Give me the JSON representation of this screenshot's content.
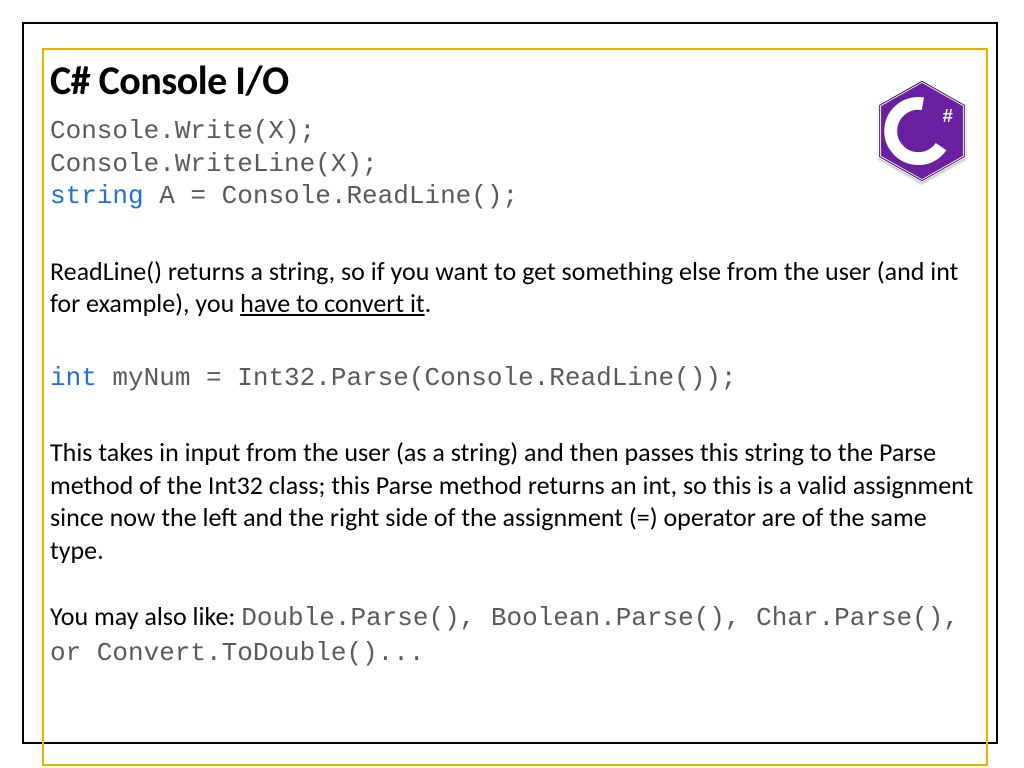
{
  "title": "C# Console I/O",
  "code1": {
    "l1": "Console.Write(X);",
    "l2": "Console.WriteLine(X);",
    "l3_kw": "string",
    "l3_rest": " A = Console.ReadLine();"
  },
  "para1": {
    "a": "ReadLine() returns a string, so if you want to get something else from the user (and int for example), you ",
    "u": "have to convert it",
    "b": "."
  },
  "code2": {
    "kw": "int",
    "rest": " myNum = Int32.Parse(Console.ReadLine());"
  },
  "para2": "This takes in input from the user (as a string) and then passes this string to the Parse method of the Int32 class; this Parse method returns an int, so this is a valid assignment since now the left and the right side of the assignment (=) operator are of the same type.",
  "para3": {
    "a": "You may also like: ",
    "code": "Double.Parse(), Boolean.Parse(), Char.Parse(), or Convert.ToDouble()..."
  },
  "logo": {
    "letter": "C",
    "hash": "#"
  }
}
